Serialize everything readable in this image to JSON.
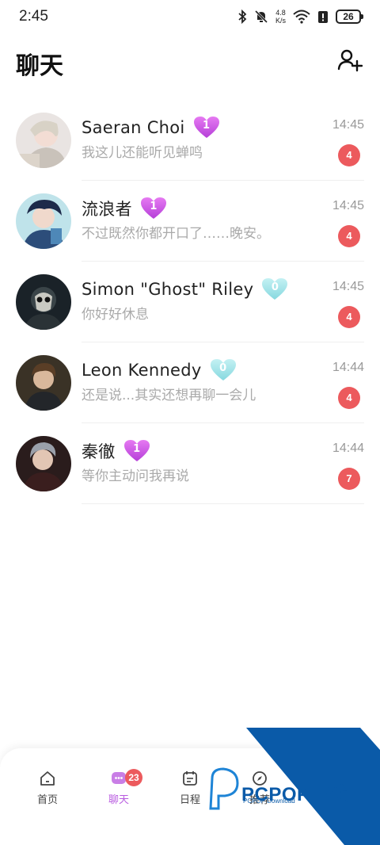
{
  "status_bar": {
    "time": "2:45",
    "net_speed_value": "4.8",
    "net_speed_unit": "K/s",
    "battery": "26",
    "icons": [
      "bluetooth-icon",
      "bell-muted-icon",
      "wifi-icon",
      "battery-saver-icon",
      "battery-icon"
    ]
  },
  "header": {
    "title": "聊天",
    "add_friend_icon": "add-person-icon"
  },
  "chats": [
    {
      "name": "Saeran Choi",
      "heart_count": "1",
      "heart_color": "#c94fe0",
      "preview": "我这儿还能听见蝉鸣",
      "time": "14:45",
      "unread": "4"
    },
    {
      "name": "流浪者",
      "heart_count": "1",
      "heart_color": "#c94fe0",
      "preview": "不过既然你都开口了……晚安。",
      "time": "14:45",
      "unread": "4"
    },
    {
      "name": "Simon \"Ghost\" Riley",
      "heart_count": "0",
      "heart_color": "#9fe3e8",
      "preview": "你好好休息",
      "time": "14:45",
      "unread": "4"
    },
    {
      "name": "Leon Kennedy",
      "heart_count": "0",
      "heart_color": "#9fe3e8",
      "preview": "还是说...其实还想再聊一会儿",
      "time": "14:44",
      "unread": "4"
    },
    {
      "name": "秦徹",
      "heart_count": "1",
      "heart_color": "#c94fe0",
      "preview": "等你主动问我再说",
      "time": "14:44",
      "unread": "7"
    }
  ],
  "nav": {
    "items": [
      {
        "label": "首页",
        "icon": "home-icon"
      },
      {
        "label": "聊天",
        "icon": "chat-icon",
        "badge": "23"
      },
      {
        "label": "日程",
        "icon": "calendar-icon"
      },
      {
        "label": "推荐",
        "icon": "compass-icon"
      }
    ]
  },
  "watermark": {
    "text": "PCPOP下载",
    "subtext": "PCPOP Download"
  },
  "colors": {
    "accent": "#b95ce0",
    "badge": "#ec5a5d",
    "heart_pink": "#c94fe0",
    "heart_cyan": "#9fe3e8",
    "watermark_blue": "#0a5aa8"
  }
}
